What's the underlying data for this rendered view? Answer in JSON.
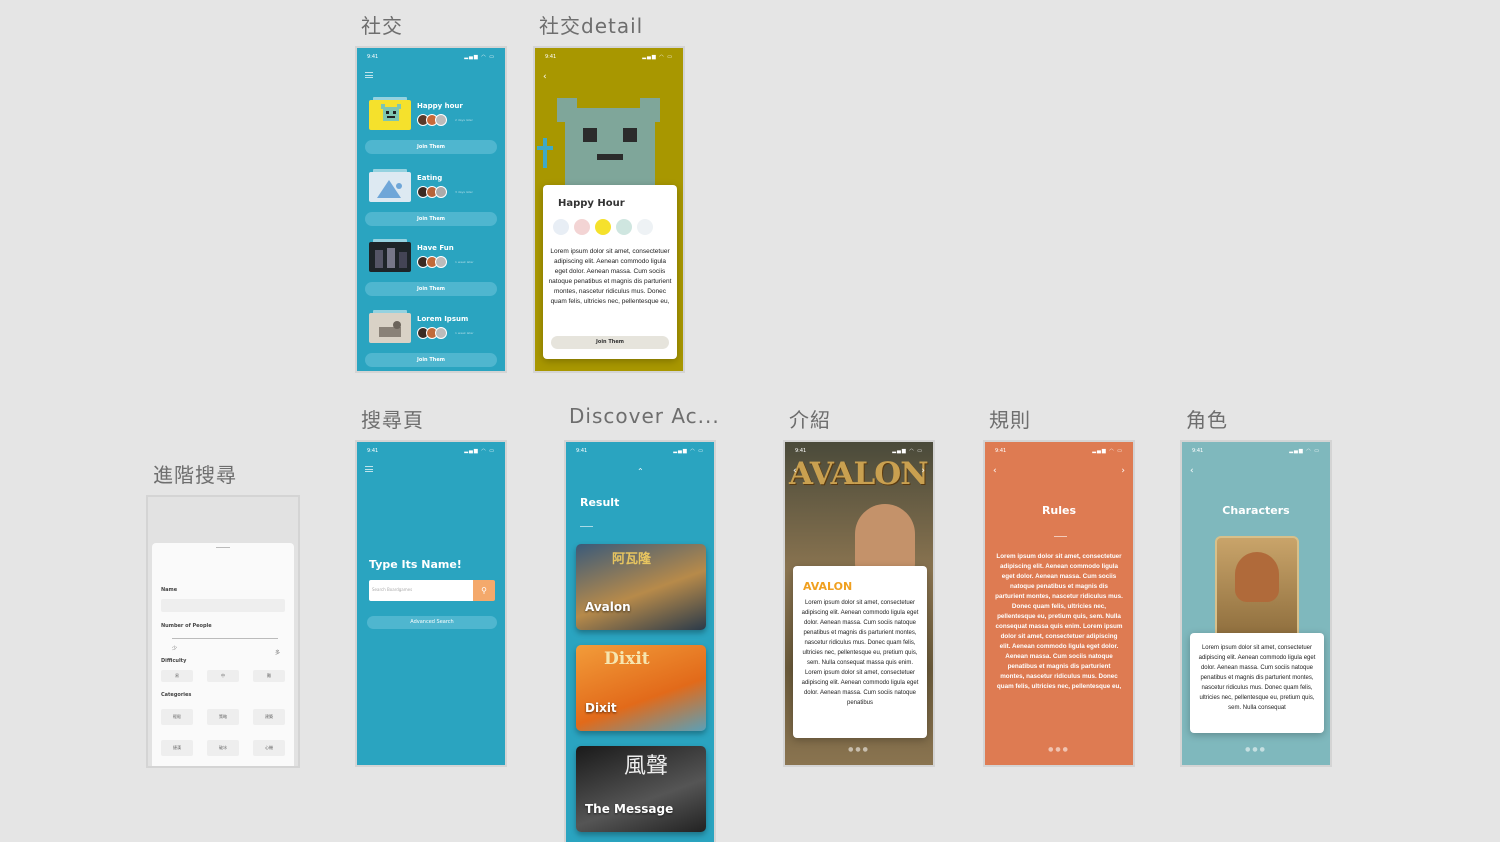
{
  "labels": {
    "social": "社交",
    "social_detail": "社交detail",
    "search": "搜尋頁",
    "discover": "Discover Ac...",
    "intro": "介紹",
    "rules": "規則",
    "characters": "角色",
    "advanced": "進階搜尋"
  },
  "status_time": "9:41",
  "social": {
    "join_label": "Join Them",
    "groups": [
      {
        "name": "Happy hour",
        "time": "2 days later"
      },
      {
        "name": "Eating",
        "time": "3 days later"
      },
      {
        "name": "Have Fun",
        "time": "1 week later"
      },
      {
        "name": "Lorem Ipsum",
        "time": "1 week later"
      }
    ]
  },
  "detail": {
    "title": "Happy Hour",
    "body": "Lorem ipsum dolor sit amet, consectetuer adipiscing elit. Aenean commodo ligula eget dolor. Aenean massa. Cum sociis natoque penatibus et magnis dis parturient montes, nascetur ridiculus mus. Donec quam felis, ultricies nec, pellentesque eu,",
    "join_label": "Join Them"
  },
  "advanced": {
    "name_label": "Name",
    "people_label": "Number of People",
    "people_min": "少",
    "people_max": "多",
    "difficulty_label": "Difficulty",
    "difficulty": [
      "易",
      "中",
      "難"
    ],
    "categories_label": "Categories",
    "categories": [
      "輕鬆",
      "策略",
      "建築",
      "捷漢",
      "破冰",
      "心機"
    ]
  },
  "search": {
    "heading": "Type Its Name!",
    "placeholder": "Search Boardgames",
    "advanced_label": "Advanced Search"
  },
  "discover": {
    "heading": "Result",
    "games": [
      "Avalon",
      "Dixit",
      "The Message"
    ]
  },
  "intro": {
    "banner": "AVALON",
    "title": "AVALON",
    "body": "Lorem ipsum dolor sit amet, consectetuer adipiscing elit. Aenean commodo ligula eget dolor. Aenean massa. Cum sociis natoque penatibus et magnis dis parturient montes, nascetur ridiculus mus. Donec quam felis, ultricies nec, pellentesque eu, pretium quis, sem. Nulla consequat massa quis enim. Lorem ipsum dolor sit amet, consectetuer adipiscing elit. Aenean commodo ligula eget dolor. Aenean massa. Cum sociis natoque penatibus"
  },
  "rules": {
    "title": "Rules",
    "body": "Lorem ipsum dolor sit amet, consectetuer adipiscing elit. Aenean commodo ligula eget dolor. Aenean massa. Cum sociis natoque penatibus et magnis dis parturient montes, nascetur ridiculus mus. Donec quam felis, ultricies nec, pellentesque eu, pretium quis, sem. Nulla consequat massa quis enim. Lorem ipsum dolor sit amet, consectetuer adipiscing elit. Aenean commodo ligula eget dolor. Aenean massa. Cum sociis natoque penatibus et magnis dis parturient montes, nascetur ridiculus mus. Donec quam felis, ultricies nec, pellentesque eu,"
  },
  "characters": {
    "title": "Characters",
    "body": "Lorem ipsum dolor sit amet, consectetuer adipiscing elit. Aenean commodo ligula eget dolor. Aenean massa. Cum sociis natoque penatibus et magnis dis parturient montes, nascetur ridiculus mus. Donec quam felis, ultricies nec, pellentesque eu, pretium quis, sem. Nulla consequat"
  },
  "colors": {
    "teal": "#2aa4c0",
    "mustard": "#a89700",
    "orange": "#de7b52",
    "sage": "#7fb8bd",
    "accent": "#f0a020"
  }
}
